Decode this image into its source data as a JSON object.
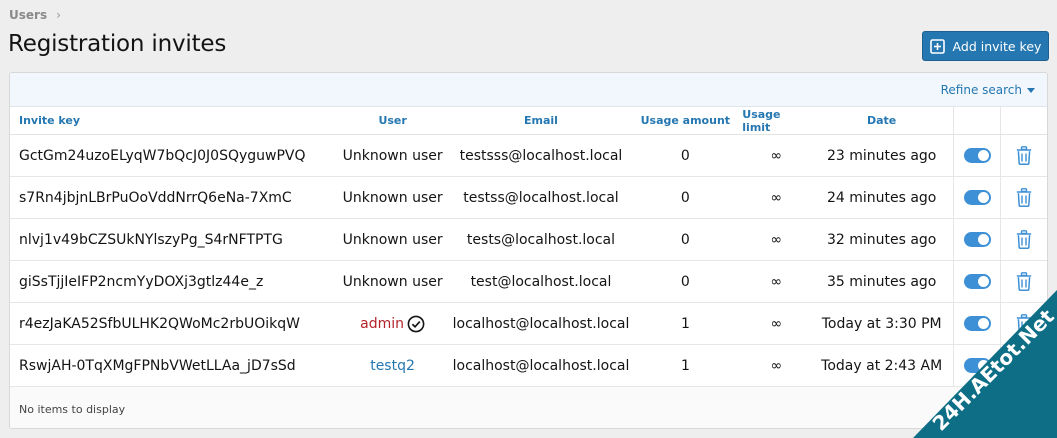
{
  "breadcrumb": {
    "item": "Users"
  },
  "page": {
    "title": "Registration invites"
  },
  "toolbar": {
    "add_label": "Add invite key"
  },
  "filter": {
    "refine_label": "Refine search"
  },
  "table": {
    "headers": {
      "key": "Invite key",
      "user": "User",
      "email": "Email",
      "amount": "Usage amount",
      "limit": "Usage limit",
      "date": "Date"
    },
    "rows": [
      {
        "key": "GctGm24uzoELyqW7bQcJ0J0SQyguwPVQ",
        "user": "Unknown user",
        "user_style": "plain",
        "email": "testsss@localhost.local",
        "amount": "0",
        "limit": "∞",
        "date": "23 minutes ago",
        "enabled": true
      },
      {
        "key": "s7Rn4jbjnLBrPuOoVddNrrQ6eNa-7XmC",
        "user": "Unknown user",
        "user_style": "plain",
        "email": "testss@localhost.local",
        "amount": "0",
        "limit": "∞",
        "date": "24 minutes ago",
        "enabled": true
      },
      {
        "key": "nlvj1v49bCZSUkNYlszyPg_S4rNFTPTG",
        "user": "Unknown user",
        "user_style": "plain",
        "email": "tests@localhost.local",
        "amount": "0",
        "limit": "∞",
        "date": "32 minutes ago",
        "enabled": true
      },
      {
        "key": "giSsTjjIeIFP2ncmYyDOXj3gtlz44e_z",
        "user": "Unknown user",
        "user_style": "plain",
        "email": "test@localhost.local",
        "amount": "0",
        "limit": "∞",
        "date": "35 minutes ago",
        "enabled": true
      },
      {
        "key": "r4ezJaKA52SfbULHK2QWoMc2rbUOikqW",
        "user": "admin",
        "user_style": "admin",
        "email": "localhost@localhost.local",
        "amount": "1",
        "limit": "∞",
        "date": "Today at 3:30 PM",
        "enabled": true
      },
      {
        "key": "RswjAH-0TqXMgFPNbVWetLLAa_jD7sSd",
        "user": "testq2",
        "user_style": "link",
        "email": "localhost@localhost.local",
        "amount": "1",
        "limit": "∞",
        "date": "Today at 2:43 AM",
        "enabled": true
      }
    ],
    "footer": "No items to display"
  },
  "watermark": {
    "text": "24H.AEtot.Net"
  },
  "colors": {
    "accent": "#2577b1",
    "admin": "#b4232c",
    "toggle_on": "#3d8fd6",
    "trash": "#3d8fd6"
  },
  "icons": {
    "add": "plus-square-icon",
    "refine": "caret-down-icon",
    "delete": "trash-icon",
    "verified": "check-circle-icon"
  }
}
